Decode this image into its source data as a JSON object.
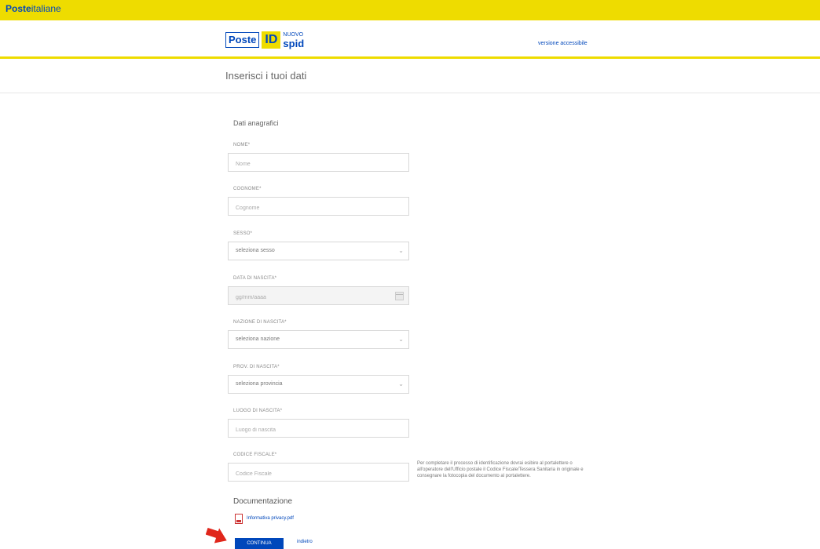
{
  "topbar": {
    "brand_bold": "Poste",
    "brand_rest": "italiane"
  },
  "logo": {
    "poste": "Poste",
    "id": "ID",
    "nuovo": "NUOVO",
    "spid": "spid"
  },
  "header": {
    "access_link": "versione accessibile"
  },
  "page": {
    "title": "Inserisci i tuoi dati"
  },
  "form": {
    "section_title": "Dati anagrafici",
    "fields": [
      {
        "label": "NOME*",
        "placeholder": "Nome"
      },
      {
        "label": "COGNOME*",
        "placeholder": "Cognome"
      },
      {
        "label": "SESSO*",
        "value": "seleziona sesso"
      },
      {
        "label": "DATA DI NASCITA*",
        "placeholder": "gg/mm/aaaa"
      },
      {
        "label": "NAZIONE DI NASCITA*",
        "value": "seleziona nazione"
      },
      {
        "label": "PROV. DI NASCITA*",
        "value": "seleziona provincia"
      },
      {
        "label": "LUOGO DI NASCITA*",
        "placeholder": "Luogo di nascita"
      },
      {
        "label": "CODICE FISCALE*",
        "placeholder": "Codice Fiscale"
      }
    ],
    "help_text": "Per completare il processo di identificazione dovrai esibire al portalettere o all'operatore dell'Ufficio postale il Codice Fiscale/Tessera Sanitaria in originale e consegnare la fotocopia del documento al portalettere."
  },
  "documents": {
    "title": "Documentazione",
    "privacy_link": "Informativa privacy.pdf"
  },
  "actions": {
    "continue_label": "CONTINUA",
    "back_label": "indietro"
  },
  "icons": {
    "arrow": "red-arrow-icon",
    "pdf": "pdf-file-icon",
    "calendar": "calendar-icon",
    "chevron": "chevron-down-icon"
  },
  "colors": {
    "yellow": "#eedc00",
    "blue": "#0047bb",
    "arrow": "#e0261b"
  }
}
